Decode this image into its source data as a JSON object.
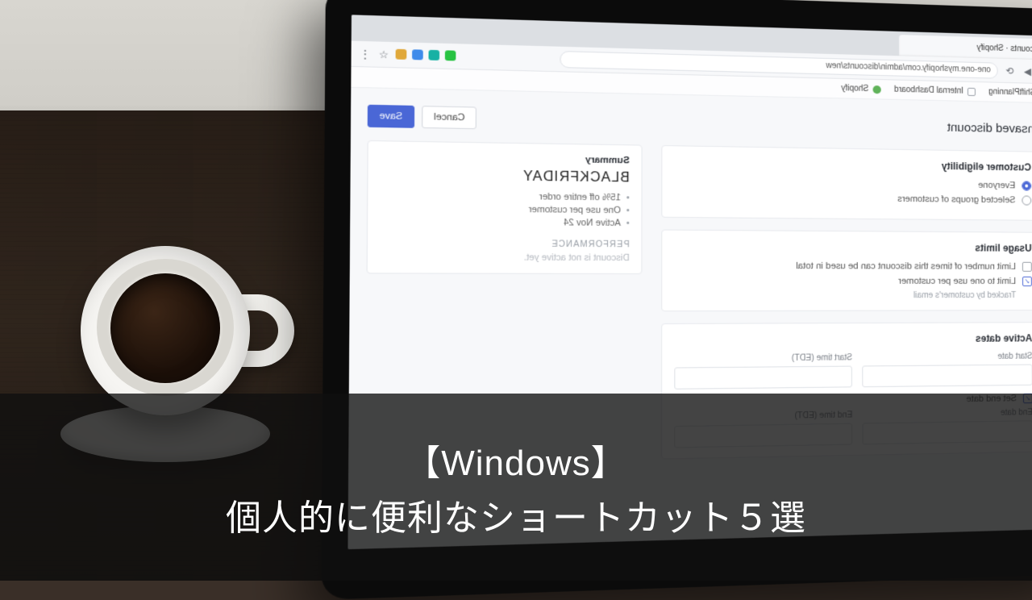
{
  "overlay": {
    "line1": "【Windows】",
    "line2": "個人的に便利なショートカット５選"
  },
  "browser": {
    "tab_title": "Discounts · Shopify",
    "url": "one-one.myshopify.com/admin/discounts/new",
    "bookmarks": [
      {
        "label": "ShiftPlanning"
      },
      {
        "label": "Internal Dashboard"
      },
      {
        "label": "Shopify"
      }
    ]
  },
  "app": {
    "title": "Unsaved discount",
    "save_label": "Save",
    "cancel_label": "Cancel",
    "eligibility": {
      "heading": "Customer eligibility",
      "option_everyone": "Everyone",
      "option_groups": "Selected groups of customers"
    },
    "usage": {
      "heading": "Usage limits",
      "opt_total": "Limit number of times this discount can be used in total",
      "opt_one": "Limit to one use per customer",
      "note": "Tracked by customer's email"
    },
    "dates": {
      "heading": "Active dates",
      "start_date": "Start date",
      "start_time": "Start time (EDT)",
      "end_date": "End date",
      "end_time": "End time (EDT)",
      "set_end": "Set end date"
    },
    "summary": {
      "heading": "Summary",
      "code": "BLACKFRIDAY",
      "bullets": [
        "15% off entire order",
        "One use per customer",
        "Active Nov 24"
      ],
      "perf_heading": "PERFORMANCE",
      "perf_note": "Discount is not active yet."
    }
  }
}
